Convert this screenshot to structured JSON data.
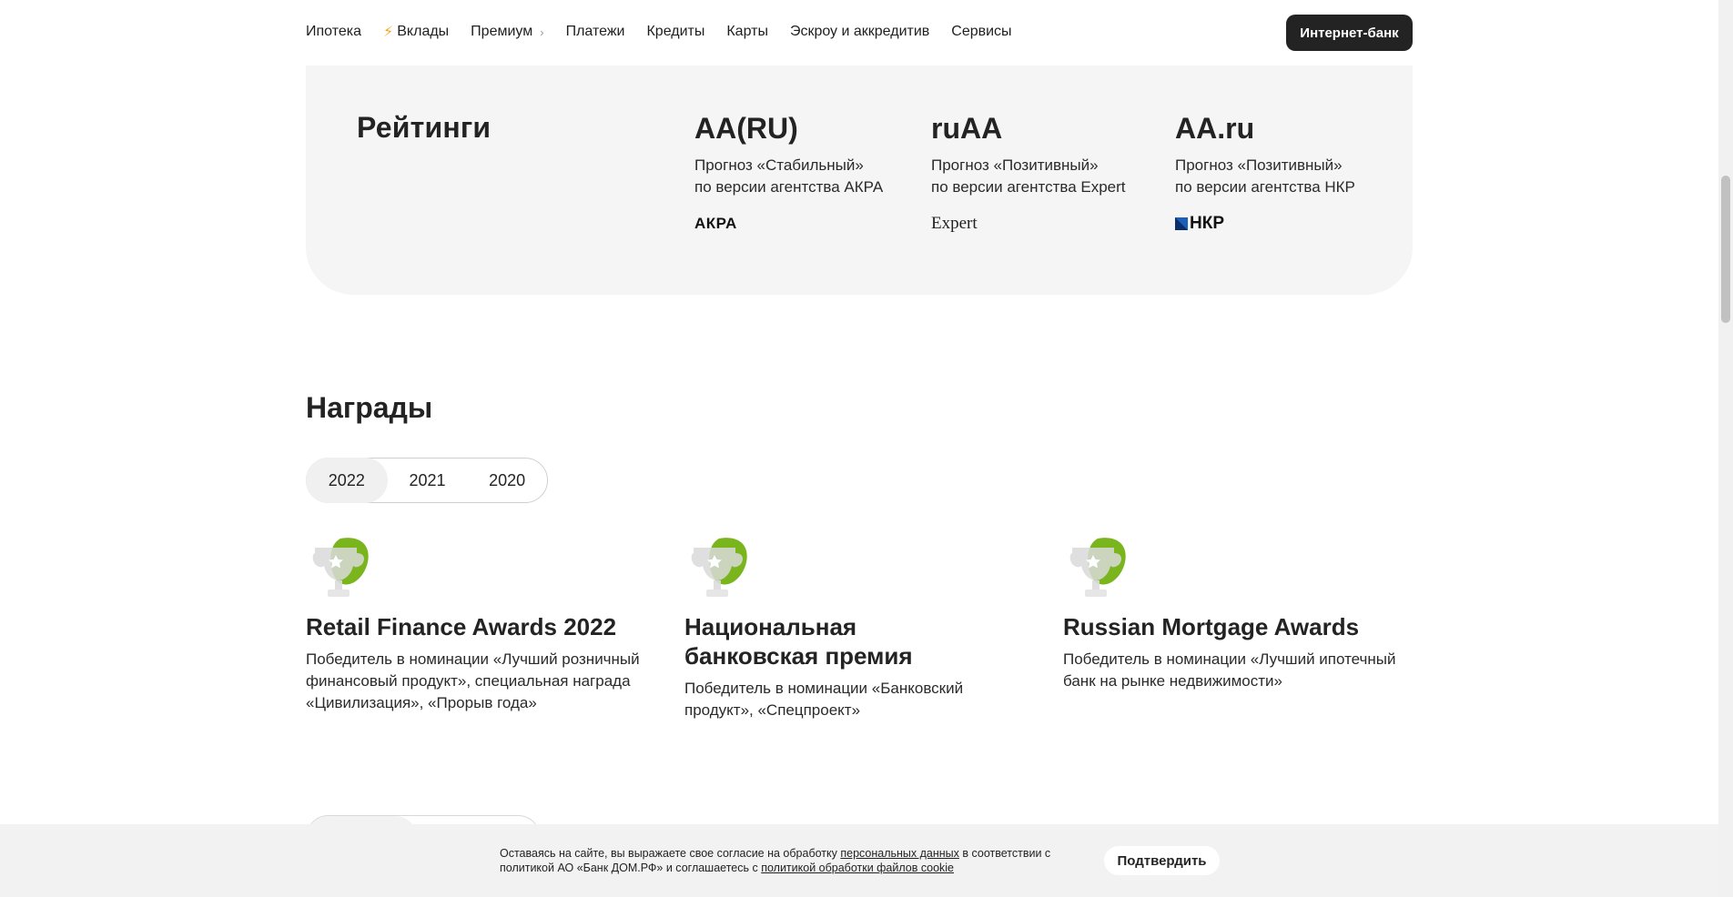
{
  "nav": {
    "items": [
      {
        "label": "Ипотека"
      },
      {
        "label": "Вклады",
        "icon": "lightning-icon"
      },
      {
        "label": "Премиум",
        "icon": "chevron-right-icon"
      },
      {
        "label": "Платежи"
      },
      {
        "label": "Кредиты"
      },
      {
        "label": "Карты"
      },
      {
        "label": "Эскроу и аккредитив"
      },
      {
        "label": "Сервисы"
      }
    ],
    "internet_bank": "Интернет-банк"
  },
  "ratings": {
    "title": "Рейтинги",
    "items": [
      {
        "value": "AA(RU)",
        "line1": "Прогноз «Стабильный»",
        "line2": "по версии агентства АКРА",
        "logo": "АКРА"
      },
      {
        "value": "ruAA",
        "line1": "Прогноз «Позитивный»",
        "line2": "по версии агентства Expert",
        "logo": "Expert"
      },
      {
        "value": "AA.ru",
        "line1": "Прогноз «Позитивный»",
        "line2": "по версии агентства НКР",
        "logo": "НКР"
      }
    ]
  },
  "awards": {
    "title": "Награды",
    "tabs": [
      "2022",
      "2021",
      "2020"
    ],
    "active_tab": "2022",
    "items": [
      {
        "name": "Retail Finance Awards 2022",
        "text": "Победитель в номинации «Лучший розничный финансовый продукт», специальная награда «Цивилизация», «Прорыв года»"
      },
      {
        "name": "Национальная банковская премия",
        "text": "Победитель в номинации «Банковский продукт», «Спецпроект»"
      },
      {
        "name": "Russian Mortgage Awards",
        "text": "Победитель в номинации «Лучший ипотечный банк на рынке недвижимости»"
      }
    ]
  },
  "cookie": {
    "text_a": "Оставаясь на сайте, вы выражаете свое согласие на обработку ",
    "link1": "персональных данных",
    "text_b": " в соответствии с политикой АО «Банк ДОМ.РФ» и соглашаетесь с ",
    "link2": "политикой обработки файлов cookie",
    "confirm": "Подтвердить"
  },
  "colors": {
    "accent_green": "#7ab51d",
    "dark_button": "#232323",
    "card_bg": "#f5f5f5",
    "lightning": "#f5a623"
  }
}
